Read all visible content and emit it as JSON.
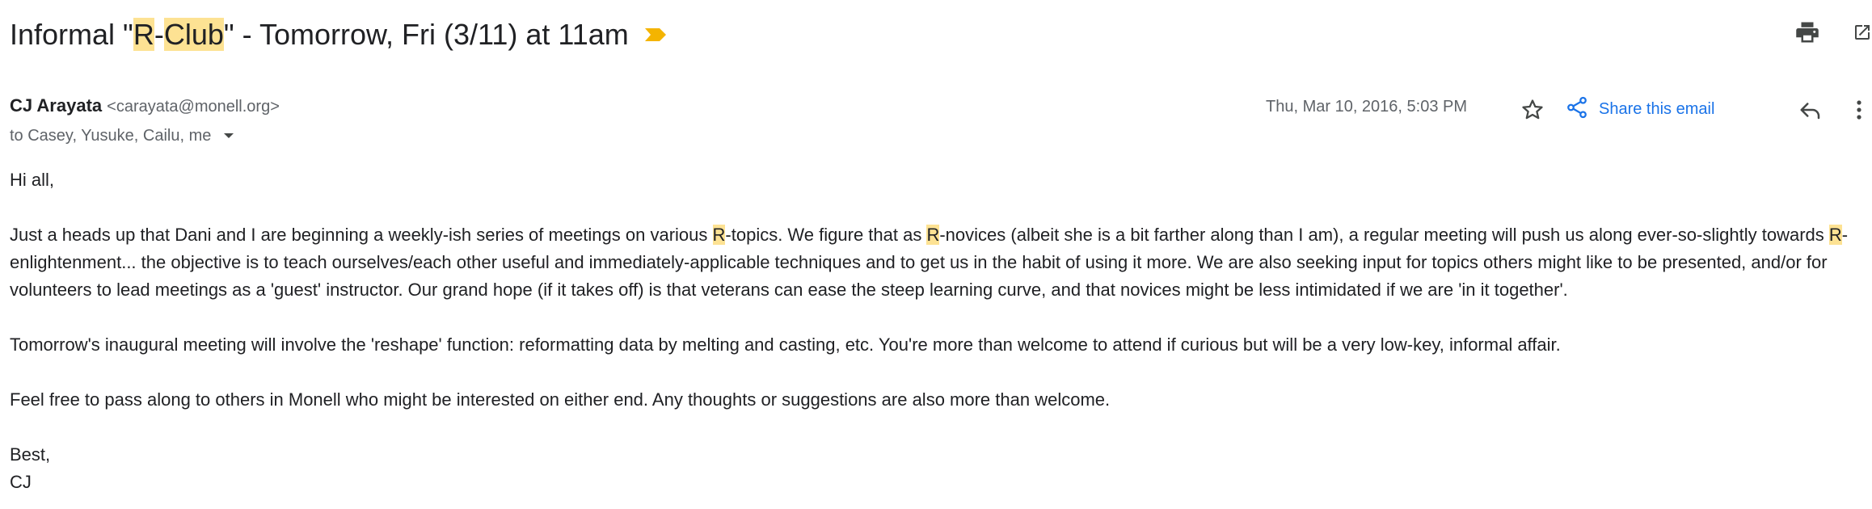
{
  "subject": {
    "prefix": "Informal \"",
    "hl1": "R",
    "dash": "-",
    "hl2": "Club",
    "suffix": "\" - Tomorrow, Fri (3/11) at 11am"
  },
  "icons": {
    "important": "importance-marker-icon",
    "print": "print-icon",
    "open_new": "open-in-new-window-icon",
    "star": "star-icon",
    "share": "share-icon",
    "reply": "reply-icon",
    "more": "more-vert-icon",
    "caret": "caret-down-icon"
  },
  "colors": {
    "highlight": "#fde293",
    "important": "#f4b400",
    "link": "#1a73e8",
    "text": "#202124",
    "muted": "#5f6368"
  },
  "sender": {
    "name": "CJ Arayata",
    "email": "<carayata@monell.org>"
  },
  "recipients": "to Casey, Yusuke, Cailu, me",
  "date": "Thu, Mar 10, 2016, 5:03 PM",
  "share_label": "Share this email",
  "body": {
    "greeting": "Hi all,",
    "p1": {
      "a": "Just a heads up that Dani and I are beginning a weekly-ish series of meetings on various ",
      "r1": "R",
      "b": "-topics. We figure that as ",
      "r2": "R",
      "c": "-novices (albeit she is a bit farther along than I am), a regular meeting will push us along ever-so-slightly towards ",
      "r3": "R",
      "d": "-enlightenment... the objective is to teach ourselves/each other useful and immediately-applicable techniques and to get us in the habit of using it more. We are also seeking input for topics others might like to be presented, and/or for volunteers to lead meetings as a 'guest' instructor. Our grand hope (if it takes off) is that veterans can ease the steep learning curve, and that novices might be less intimidated if we are 'in it together'."
    },
    "p2": "Tomorrow's inaugural meeting will involve the 'reshape' function: reformatting data by melting and casting, etc. You're more than welcome to attend if curious but will be a very low-key, informal affair.",
    "p3": "Feel free to pass along to others in Monell who might be interested on either end. Any thoughts or suggestions are also more than welcome.",
    "signoff": "Best,",
    "signature": "CJ"
  }
}
